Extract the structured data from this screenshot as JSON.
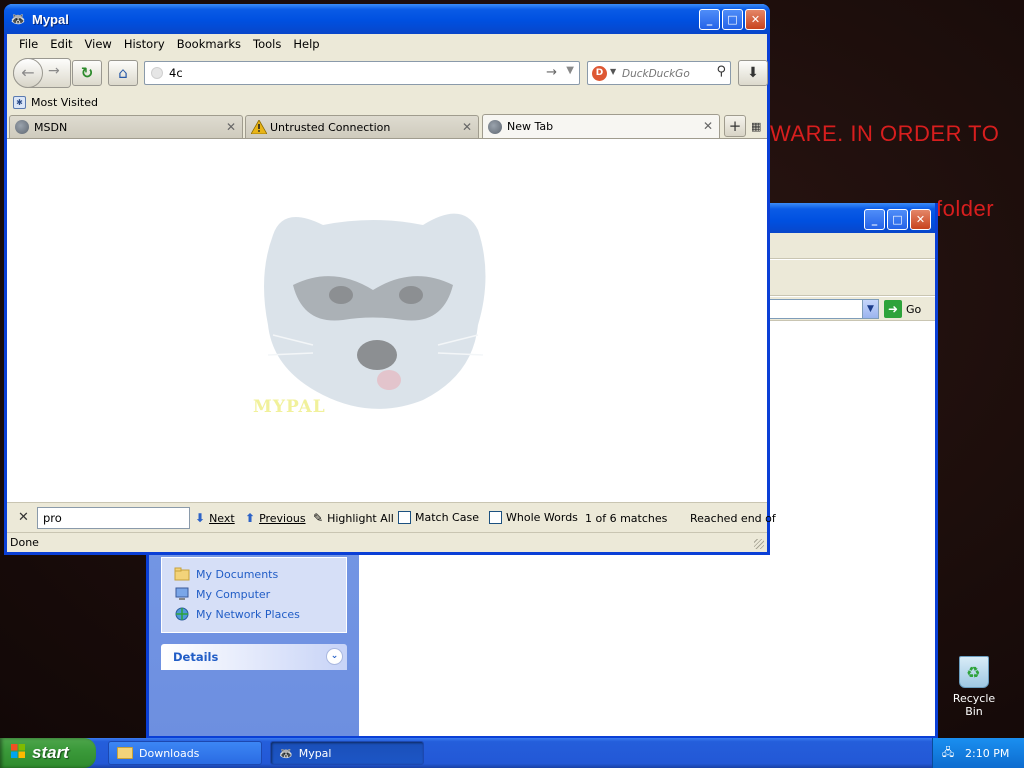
{
  "desktop": {
    "text_line1": "WARE. IN ORDER TO",
    "text_line2": "folder"
  },
  "explorer": {
    "go_label": "Go",
    "tasks": [
      {
        "label": "My Documents",
        "icon": "folder-icon"
      },
      {
        "label": "My Computer",
        "icon": "computer-icon"
      },
      {
        "label": "My Network Places",
        "icon": "network-icon"
      }
    ],
    "details_label": "Details"
  },
  "browser": {
    "title": "Mypal",
    "menu": [
      "File",
      "Edit",
      "View",
      "History",
      "Bookmarks",
      "Tools",
      "Help"
    ],
    "url_value": "4c",
    "search_placeholder": "DuckDuckGo",
    "bookmarks_label": "Most Visited",
    "tabs": [
      {
        "label": "MSDN",
        "icon": "globe-icon"
      },
      {
        "label": "Untrusted Connection",
        "icon": "warning-icon"
      },
      {
        "label": "New Tab",
        "icon": "globe-icon",
        "active": true
      }
    ],
    "mascot_label": "MYPAL",
    "find": {
      "value": "pro",
      "next_label": "Next",
      "previous_label": "Previous",
      "highlight_label": "Highlight All",
      "match_case_label": "Match Case",
      "whole_words_label": "Whole Words",
      "match_count": "1 of 6 matches",
      "status": "Reached end of"
    },
    "status_text": "Done"
  },
  "recycle_bin_label": "Recycle Bin",
  "taskbar": {
    "start_label": "start",
    "buttons": [
      {
        "label": "Downloads"
      },
      {
        "label": "Mypal"
      }
    ],
    "clock": "2:10 PM"
  },
  "colors": {
    "xp_title_blue": "#0050e0",
    "desktop_text_red": "#d81e1e",
    "start_green": "#3b9a3a",
    "taskbar_blue": "#245edb"
  }
}
